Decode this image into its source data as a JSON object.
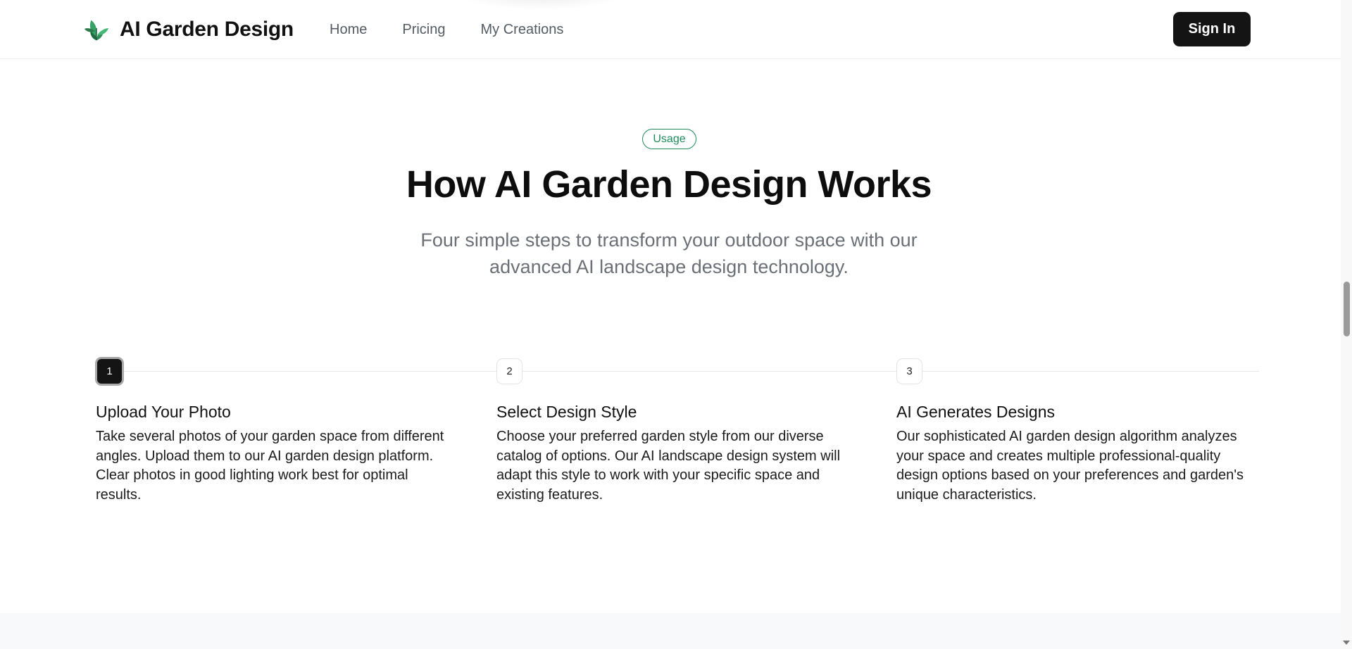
{
  "header": {
    "brand_name": "AI Garden Design",
    "nav": [
      "Home",
      "Pricing",
      "My Creations"
    ],
    "sign_in_label": "Sign In"
  },
  "section": {
    "badge": "Usage",
    "title": "How AI Garden Design Works",
    "subtitle": "Four simple steps to transform your outdoor space with our advanced AI landscape design technology."
  },
  "steps": [
    {
      "number": "1",
      "title": "Upload Your Photo",
      "description": "Take several photos of your garden space from different angles. Upload them to our AI garden design platform. Clear photos in good lighting work best for optimal results.",
      "active": true
    },
    {
      "number": "2",
      "title": "Select Design Style",
      "description": "Choose your preferred garden style from our diverse catalog of options. Our AI landscape design system will adapt this style to work with your specific space and existing features.",
      "active": false
    },
    {
      "number": "3",
      "title": "AI Generates Designs",
      "description": "Our sophisticated AI garden design algorithm analyzes your space and creates multiple professional-quality design options based on your preferences and garden's unique characteristics.",
      "active": false
    }
  ],
  "colors": {
    "accent_green": "#1f8a5b",
    "button_dark": "#141414",
    "muted_text": "#6b6f76"
  },
  "icons": {
    "brand": "leaf-plant-icon"
  }
}
